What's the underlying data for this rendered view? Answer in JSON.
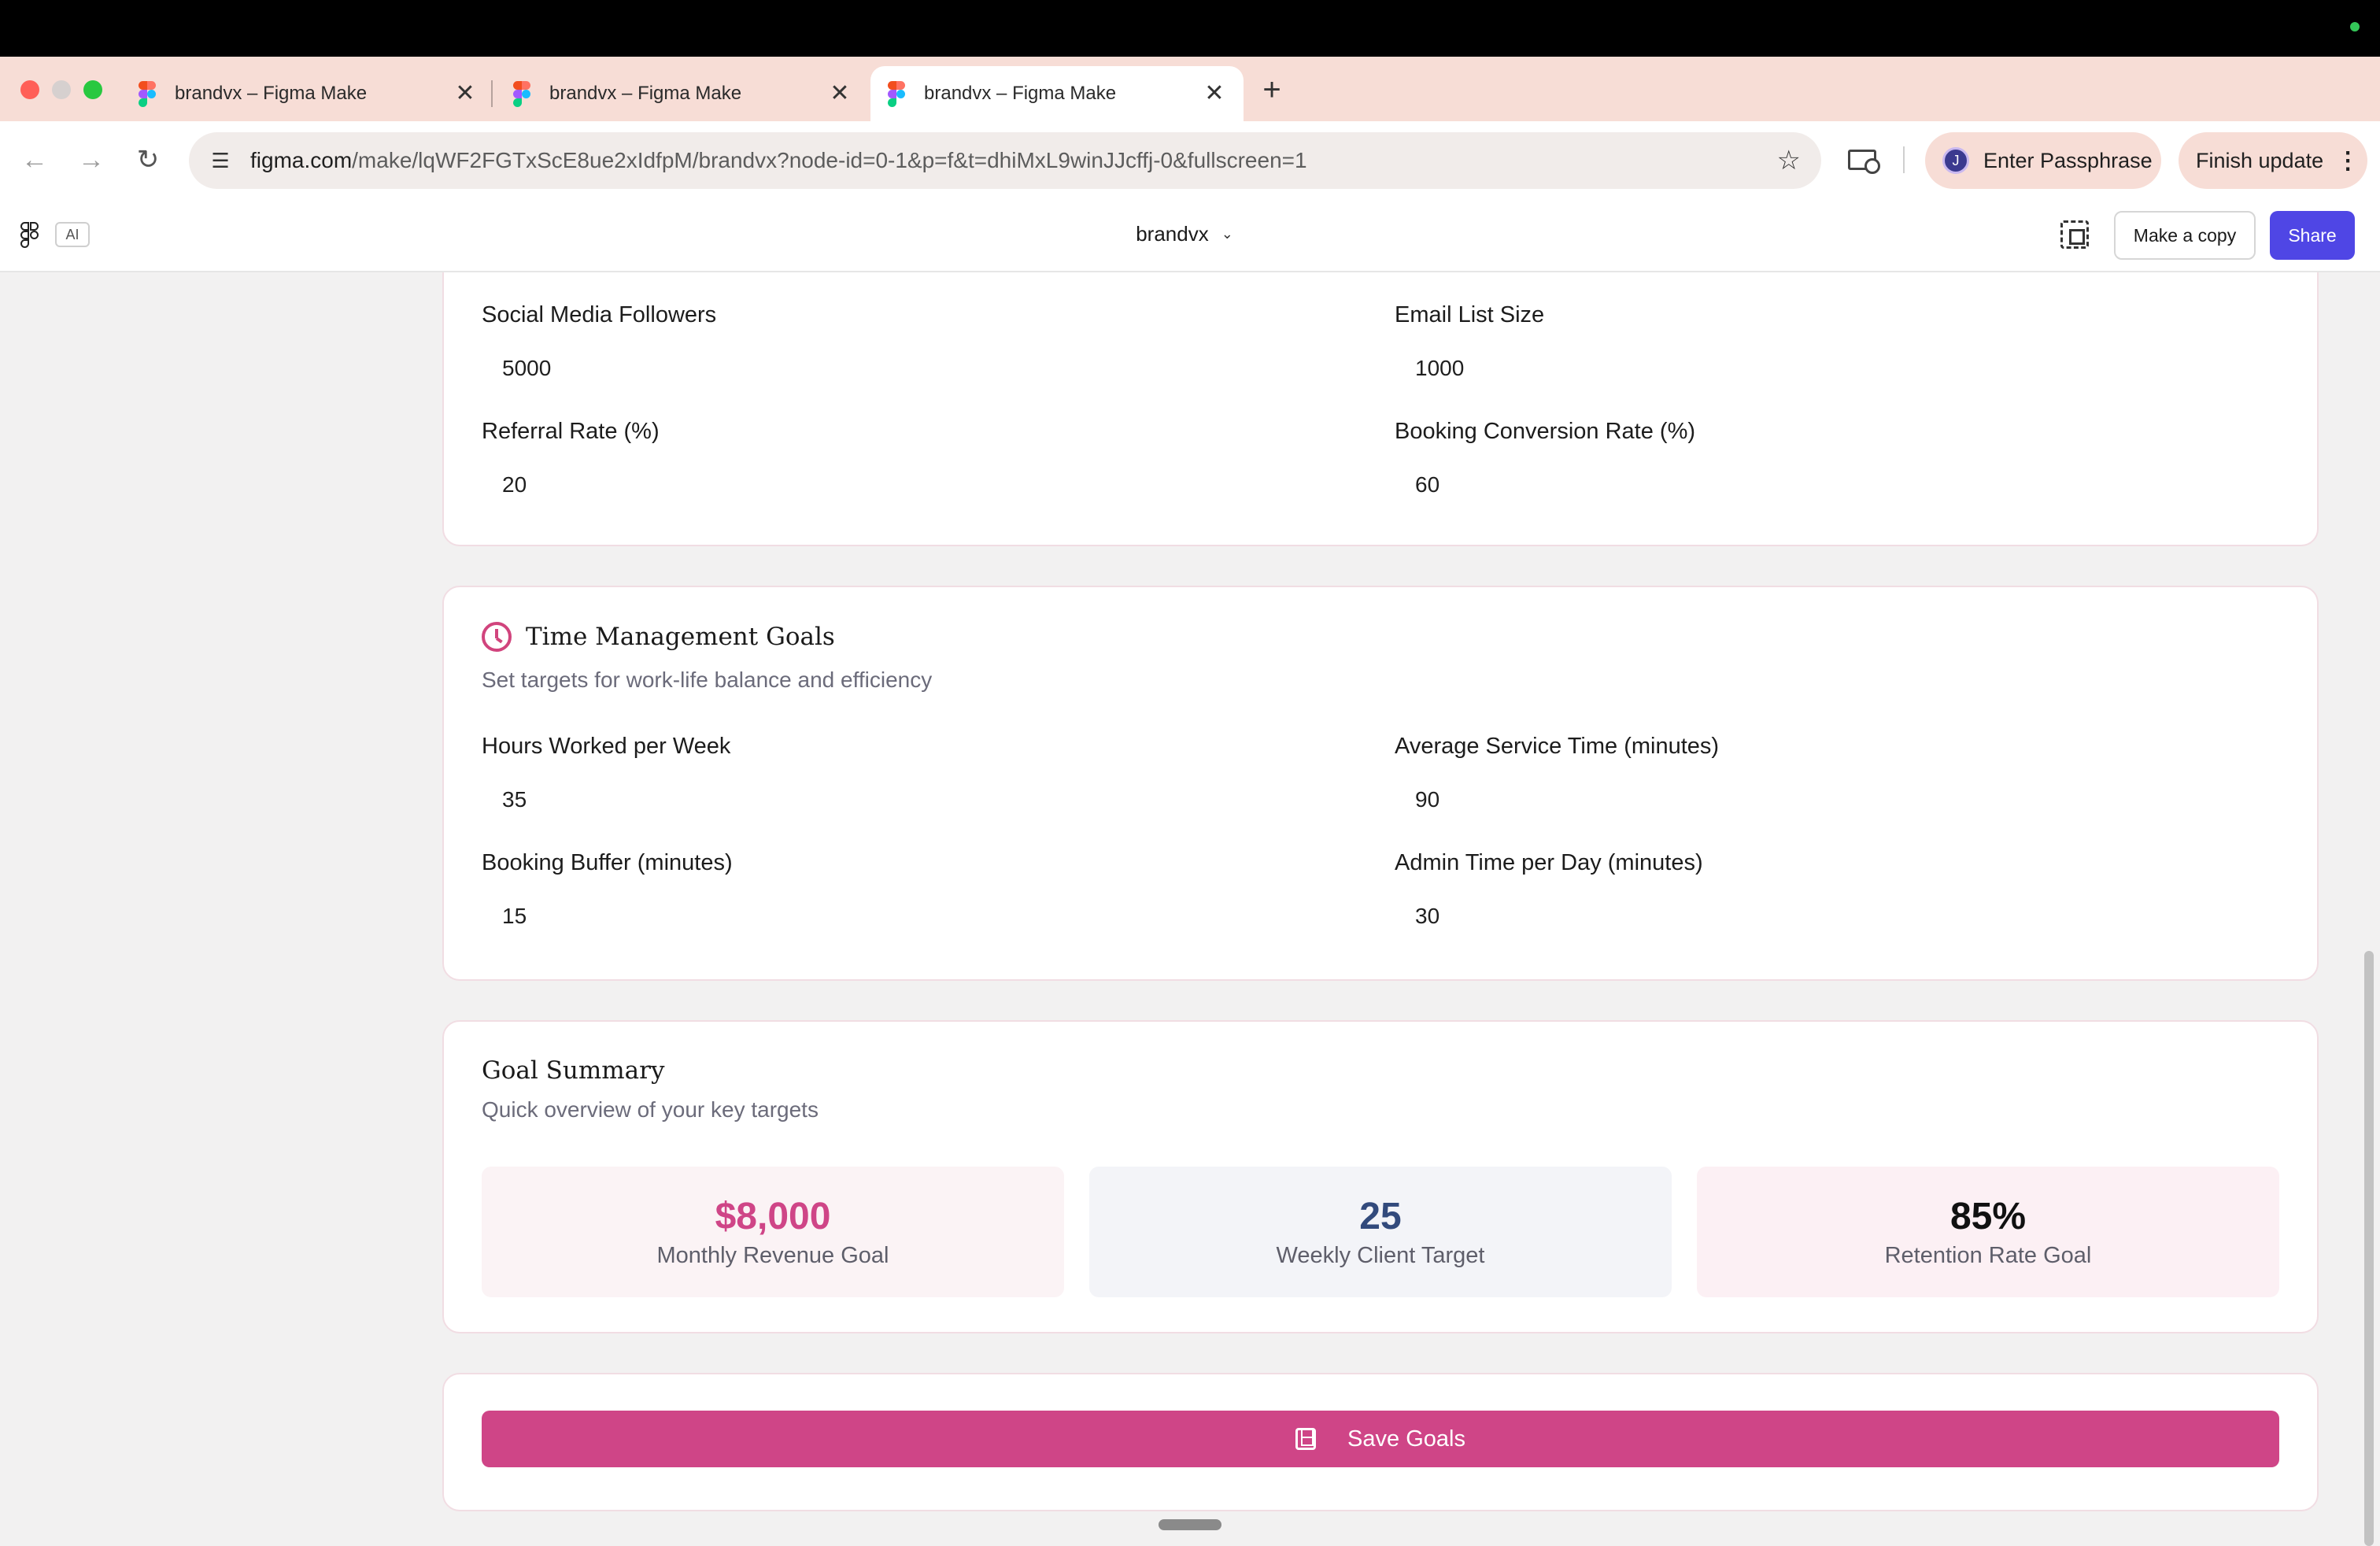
{
  "browser": {
    "tabs": [
      {
        "title": "brandvx – Figma Make",
        "active": false
      },
      {
        "title": "brandvx – Figma Make",
        "active": false
      },
      {
        "title": "brandvx – Figma Make",
        "active": true
      }
    ],
    "close_glyph": "✕",
    "new_tab_glyph": "+",
    "url_host": "figma.com",
    "url_path": "/make/lqWF2FGTxScE8ue2xIdfpM/brandvx?node-id=0-1&p=f&t=dhiMxL9winJJcffj-0&fullscreen=1",
    "profile_initial": "J",
    "passphrase_label": "Enter Passphrase",
    "update_label": "Finish update"
  },
  "appbar": {
    "ai_badge": "AI",
    "project_name": "brandvx",
    "make_copy_label": "Make a copy",
    "share_label": "Share"
  },
  "metrics": {
    "fields": [
      {
        "label": "Social Media Followers",
        "value": "5000"
      },
      {
        "label": "Email List Size",
        "value": "1000"
      },
      {
        "label": "Referral Rate (%)",
        "value": "20"
      },
      {
        "label": "Booking Conversion Rate (%)",
        "value": "60"
      }
    ]
  },
  "time": {
    "title": "Time Management Goals",
    "subtitle": "Set targets for work-life balance and efficiency",
    "fields": [
      {
        "label": "Hours Worked per Week",
        "value": "35"
      },
      {
        "label": "Average Service Time (minutes)",
        "value": "90"
      },
      {
        "label": "Booking Buffer (minutes)",
        "value": "15"
      },
      {
        "label": "Admin Time per Day (minutes)",
        "value": "30"
      }
    ]
  },
  "summary": {
    "title": "Goal Summary",
    "subtitle": "Quick overview of your key targets",
    "stats": [
      {
        "value": "$8,000",
        "label": "Monthly Revenue Goal",
        "color": "#cf4587",
        "bg": "#fbf3f5"
      },
      {
        "value": "25",
        "label": "Weekly Client Target",
        "color": "#324a7c",
        "bg": "#f3f4f8"
      },
      {
        "value": "85%",
        "label": "Retention Rate Goal",
        "color": "#111111",
        "bg": "#fcf0f4"
      }
    ]
  },
  "save": {
    "label": "Save Goals",
    "color": "#cf4587"
  },
  "icons": [
    "figma-icon",
    "back-arrow-icon",
    "forward-arrow-icon",
    "reload-icon",
    "site-settings-icon",
    "star-icon",
    "cast-icon",
    "kebab-icon",
    "present-icon",
    "chevron-down-icon",
    "clock-icon",
    "floppy-disk-icon"
  ]
}
